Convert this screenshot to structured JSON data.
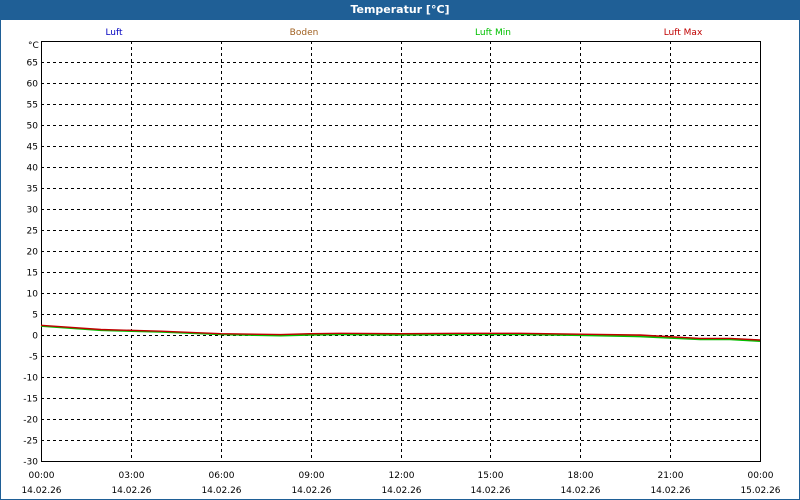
{
  "window": {
    "title": "Temperatur [°C]"
  },
  "chart_data": {
    "type": "line",
    "title": "Temperatur [°C]",
    "ylabel": "°C",
    "xlabel": "",
    "ylim": [
      -30,
      70
    ],
    "yticks": [
      65,
      60,
      55,
      50,
      45,
      40,
      35,
      30,
      25,
      20,
      15,
      10,
      5,
      0,
      -5,
      -10,
      -15,
      -20,
      -25,
      -30
    ],
    "xlim": [
      0,
      24
    ],
    "xticks": [
      {
        "x": 0,
        "time": "00:00",
        "date": "14.02.26"
      },
      {
        "x": 3,
        "time": "03:00",
        "date": "14.02.26"
      },
      {
        "x": 6,
        "time": "06:00",
        "date": "14.02.26"
      },
      {
        "x": 9,
        "time": "09:00",
        "date": "14.02.26"
      },
      {
        "x": 12,
        "time": "12:00",
        "date": "14.02.26"
      },
      {
        "x": 15,
        "time": "15:00",
        "date": "14.02.26"
      },
      {
        "x": 18,
        "time": "18:00",
        "date": "14.02.26"
      },
      {
        "x": 21,
        "time": "21:00",
        "date": "14.02.26"
      },
      {
        "x": 24,
        "time": "00:00",
        "date": "15.02.26"
      }
    ],
    "grid": true,
    "legend_position": "top",
    "series": [
      {
        "name": "Luft",
        "color": "#0000c0",
        "x": [
          0,
          2,
          4,
          6,
          8,
          9,
          10,
          12,
          14,
          16,
          18,
          20,
          22,
          23,
          24
        ],
        "y": [
          2.2,
          1.2,
          0.8,
          0.2,
          0.0,
          0.1,
          0.2,
          0.1,
          0.2,
          0.2,
          0.0,
          -0.2,
          -1.0,
          -1.0,
          -1.4
        ]
      },
      {
        "name": "Boden",
        "color": "#a06020",
        "x": [
          0,
          2,
          4,
          6,
          8,
          9,
          10,
          12,
          14,
          16,
          18,
          20,
          22,
          23,
          24
        ],
        "y": [
          2.2,
          1.2,
          0.8,
          0.2,
          0.0,
          0.1,
          0.2,
          0.1,
          0.2,
          0.2,
          0.0,
          -0.2,
          -1.0,
          -1.0,
          -1.4
        ]
      },
      {
        "name": "Luft Min",
        "color": "#00c000",
        "x": [
          0,
          2,
          4,
          6,
          8,
          9,
          10,
          12,
          14,
          16,
          18,
          20,
          22,
          23,
          24
        ],
        "y": [
          2.1,
          1.1,
          0.7,
          0.1,
          -0.2,
          0.0,
          0.1,
          0.0,
          0.1,
          0.1,
          -0.1,
          -0.4,
          -1.1,
          -1.1,
          -1.5
        ]
      },
      {
        "name": "Luft Max",
        "color": "#c00000",
        "x": [
          0,
          2,
          4,
          6,
          8,
          9,
          10,
          12,
          14,
          16,
          18,
          20,
          22,
          23,
          24
        ],
        "y": [
          2.3,
          1.3,
          0.9,
          0.3,
          0.1,
          0.3,
          0.4,
          0.3,
          0.4,
          0.4,
          0.2,
          0.0,
          -0.8,
          -0.8,
          -1.2
        ]
      }
    ]
  }
}
